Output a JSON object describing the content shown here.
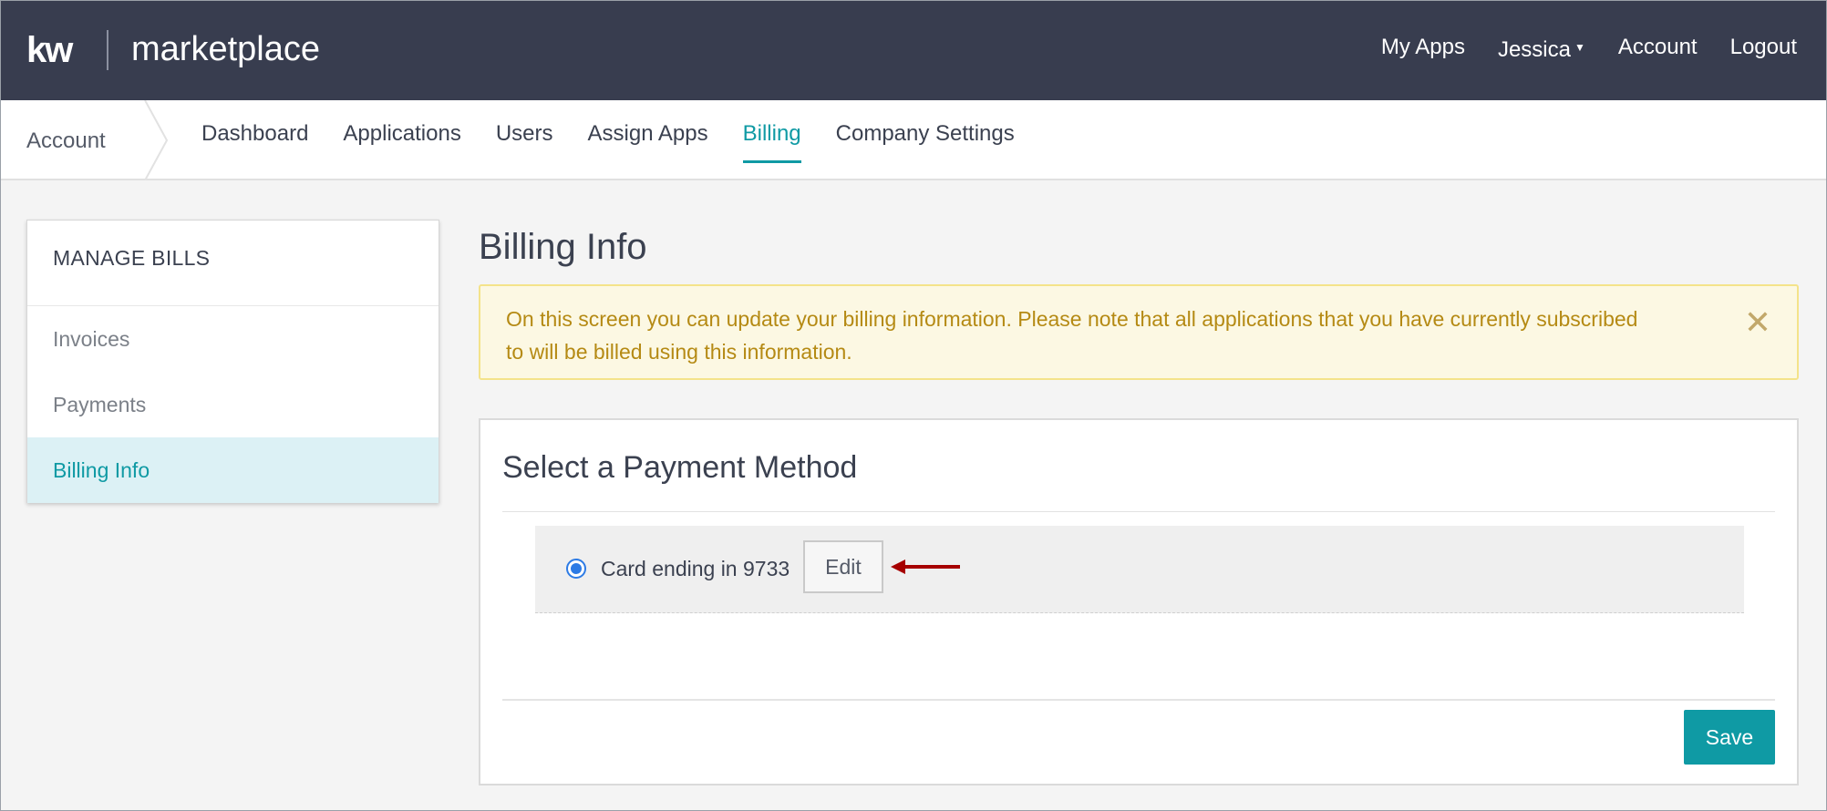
{
  "brand": {
    "logo_mark": "kw",
    "name": "marketplace"
  },
  "top_nav": {
    "my_apps": "My Apps",
    "user": "Jessica",
    "account": "Account",
    "logout": "Logout"
  },
  "sub_nav": {
    "breadcrumb": "Account",
    "tabs": [
      {
        "label": "Dashboard",
        "active": false
      },
      {
        "label": "Applications",
        "active": false
      },
      {
        "label": "Users",
        "active": false
      },
      {
        "label": "Assign Apps",
        "active": false
      },
      {
        "label": "Billing",
        "active": true
      },
      {
        "label": "Company Settings",
        "active": false
      }
    ]
  },
  "sidebar": {
    "heading": "MANAGE BILLS",
    "items": [
      {
        "label": "Invoices",
        "active": false
      },
      {
        "label": "Payments",
        "active": false
      },
      {
        "label": "Billing Info",
        "active": true
      }
    ]
  },
  "main": {
    "title": "Billing Info",
    "alert": {
      "text": "On this screen you can update your billing information. Please note that all applications that you have currently subscribed to will be billed using this information.",
      "close_icon": "close-icon"
    },
    "payment_card": {
      "title": "Select a Payment Method",
      "method_label": "Card ending in 9733",
      "method_selected": true,
      "edit_label": "Edit",
      "save_label": "Save"
    }
  },
  "colors": {
    "topbar_bg": "#383d4f",
    "accent": "#0f9aa4",
    "alert_bg": "#fcf8e3",
    "alert_text": "#b58a14",
    "arrow": "#a60000"
  }
}
